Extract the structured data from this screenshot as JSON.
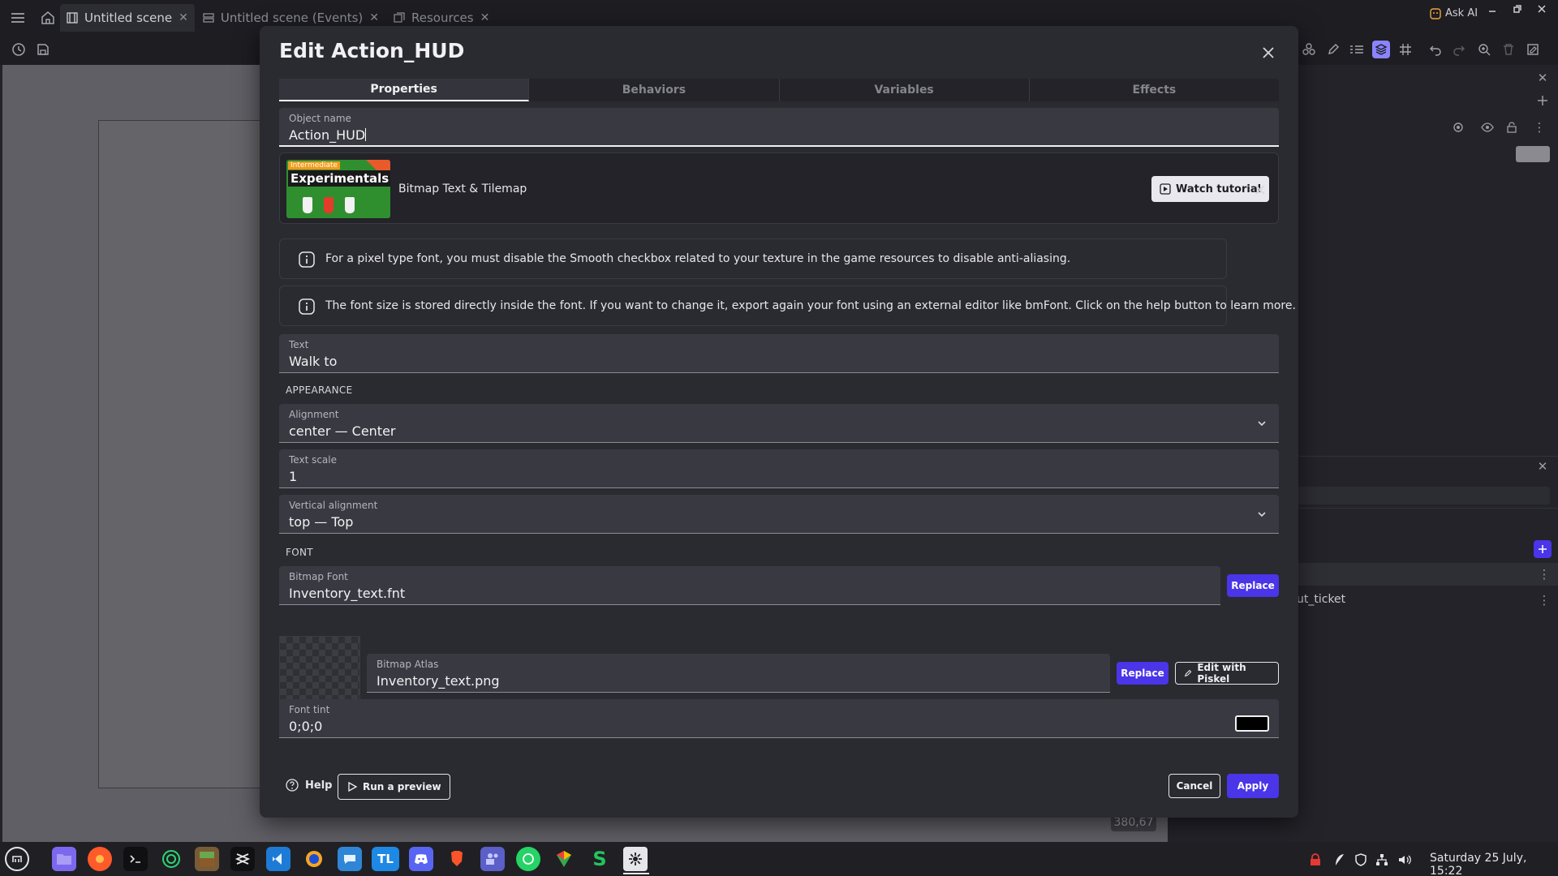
{
  "topbar": {
    "tabs": [
      {
        "label": "Untitled scene",
        "active": true
      },
      {
        "label": "Untitled scene (Events)",
        "active": false
      },
      {
        "label": "Resources",
        "active": false
      }
    ],
    "ask_ai": "Ask AI"
  },
  "canvas": {
    "coords": "380,67"
  },
  "right_panel": {
    "object_label": "ut_ticket"
  },
  "dialog": {
    "title": "Edit Action_HUD",
    "tabs": [
      "Properties",
      "Behaviors",
      "Variables",
      "Effects"
    ],
    "active_tab": "Properties",
    "object_name": {
      "label": "Object name",
      "value": "Action_HUD"
    },
    "tutorial": {
      "thumb_badge": "Intermediate",
      "thumb_title": "Experimentals",
      "name": "Bitmap Text & Tilemap",
      "watch_label": "Watch tutorial"
    },
    "infos": [
      "For a pixel type font, you must disable the Smooth checkbox related to your texture in the game resources to disable anti-aliasing.",
      "The font size is stored directly inside the font. If you want to change it, export again your font using an external editor like bmFont. Click on the help button to learn more."
    ],
    "text": {
      "label": "Text",
      "value": "Walk to"
    },
    "appearance_header": "APPEARANCE",
    "alignment": {
      "label": "Alignment",
      "value": "center — Center"
    },
    "text_scale": {
      "label": "Text scale",
      "value": "1"
    },
    "vertical_alignment": {
      "label": "Vertical alignment",
      "value": "top — Top"
    },
    "font_header": "FONT",
    "bitmap_font": {
      "label": "Bitmap Font",
      "value": "Inventory_text.fnt",
      "replace_label": "Replace"
    },
    "bitmap_atlas": {
      "label": "Bitmap Atlas",
      "value": "Inventory_text.png",
      "replace_label": "Replace",
      "edit_label": "Edit with Piskel"
    },
    "font_tint": {
      "label": "Font tint",
      "value": "0;0;0",
      "swatch_color": "#000000"
    },
    "footer": {
      "help_label": "Help",
      "preview_label": "Run a preview",
      "cancel_label": "Cancel",
      "apply_label": "Apply"
    }
  },
  "taskbar": {
    "apps": [
      "menu",
      "files",
      "firefox",
      "terminal",
      "gdevelop",
      "minecraft",
      "capcut",
      "vscode",
      "obs",
      "whatsup",
      "tl",
      "discord",
      "brave",
      "teams",
      "whatsapp",
      "maps",
      "s-app",
      "settings"
    ],
    "clock": "Saturday 25 July, 15:22"
  },
  "colors": {
    "accent": "#4a35e8",
    "dialog_bg": "#2a2a31",
    "field_bg": "#393941"
  }
}
